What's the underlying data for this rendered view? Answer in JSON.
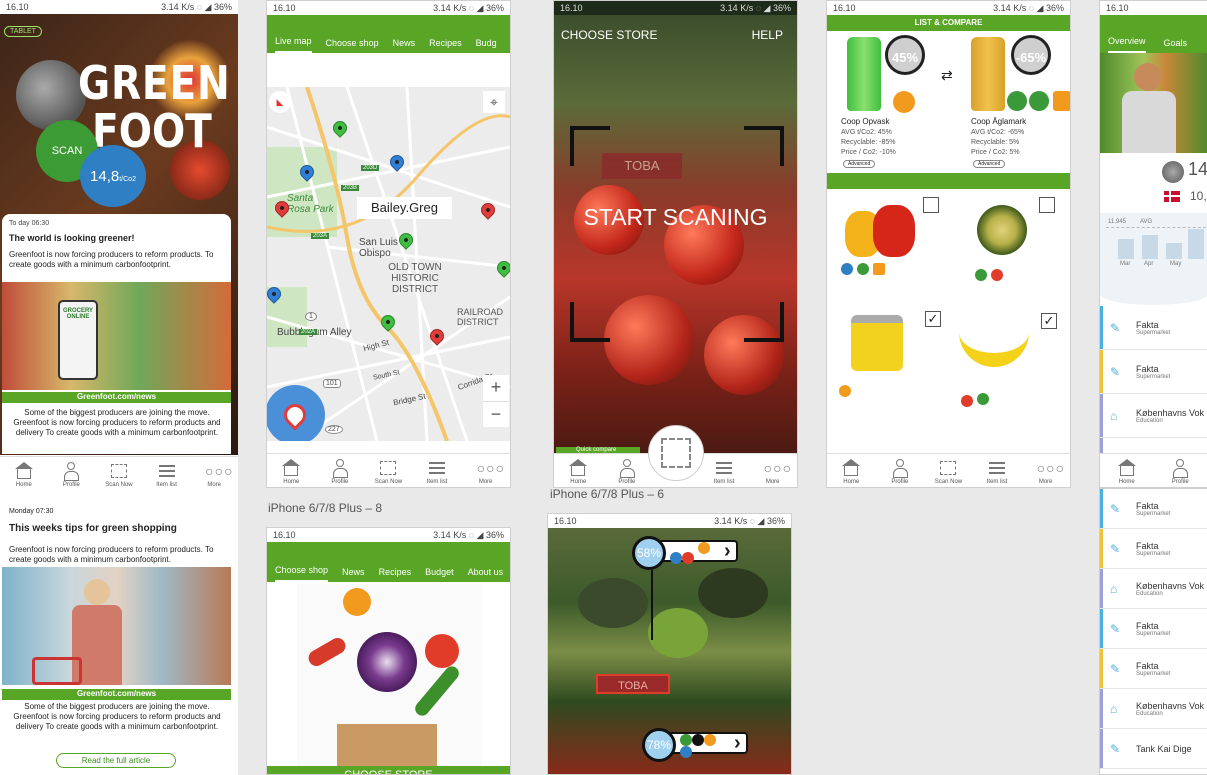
{
  "status": {
    "time": "16.10",
    "speed": "3.14 K/s",
    "battery": "36%"
  },
  "nav": {
    "home": "Home",
    "profile": "Profile",
    "scan": "Scan Now",
    "list": "Item list",
    "more": "More"
  },
  "s1": {
    "badge": "TABLET",
    "logo_line1": "GREEN",
    "logo_line2": "FOOT",
    "scan": "SCAN",
    "co2_value": "14,8",
    "co2_unit": "t/Co2",
    "news1_time": "To day 06:30",
    "news1_title": "The world is looking greener!",
    "news1_body": "Greenfoot is now forcing producers to reform products. To create goods with a minimum carbonfootprint.",
    "grocery": "GROCERY ONLINE",
    "site": "Greenfoot.com/news",
    "news1_more": "Some of the  biggest producers are joining the move. Greenfoot is now forcing producers to reform products and delivery To create goods with a minimum carbonfootprint."
  },
  "s1b": {
    "time": "Monday 07:30",
    "title": "This weeks tips for green shopping",
    "body": "Greenfoot is now forcing producers to reform products. To create goods with a minimum carbonfootprint.",
    "site": "Greenfoot.com/news",
    "more": "Some of the  biggest producers are joining the move. Greenfoot is now forcing producers to reform products and delivery To create goods with a minimum carbonfootprint.",
    "button": "Read the full article"
  },
  "s2": {
    "tabs": [
      "Live map",
      "Choose shop",
      "News",
      "Recipes",
      "Budg"
    ],
    "name_box": "Bailey.Greg",
    "streets": {
      "santa_rosa": "Santa Rosa Park",
      "san_luis": "San Luis Obispo",
      "old_town": "OLD TOWN HISTORIC DISTRICT",
      "railroad": "RAILROAD DISTRICT",
      "bubblegum": "Bubblegum Alley",
      "high": "High St",
      "south": "South St",
      "bridge": "Bridge St",
      "corrida": "Corrida Dr",
      "r101": "101",
      "r227": "227",
      "r1": "1",
      "r203a": "203A",
      "r203b": "203B",
      "r203d": "203D",
      "r202a": "202A"
    }
  },
  "s2_caption": "iPhone 6/7/8 Plus – 8",
  "s2b": {
    "tabs": [
      "Choose shop",
      "News",
      "Recipes",
      "Budget",
      "About us"
    ],
    "footer": "CHOOSE STORE"
  },
  "s3": {
    "choose": "CHOOSE STORE",
    "help": "HELP",
    "scan": "START SCANING",
    "quick": "Quick compare",
    "sign": "TOBA"
  },
  "s3_caption": "iPhone 6/7/8 Plus – 6",
  "s3b": {
    "p1": "58%",
    "p2": "78%",
    "sign": "TOBA"
  },
  "s4": {
    "header": "LIST & COMPARE",
    "p1": {
      "pct": "45%",
      "name": "Coop Opvask",
      "avg": "AVG t/Co2: 45%",
      "rec": "Recyclable: -85%",
      "price": "Price / Co2: -10%",
      "adv": "Advanced"
    },
    "p2": {
      "pct": "-65%",
      "name": "Coop Äglamark",
      "avg": "AVG t/Co2: -65%",
      "rec": "Recyclable:  5%",
      "price": "Price / Co2: 5%",
      "adv": "Advanced"
    }
  },
  "s5": {
    "tabs": [
      "Overview",
      "Goals"
    ],
    "val1": "14",
    "val2": "10,",
    "chart_labels": [
      "11,945",
      "AVG"
    ],
    "months": [
      "Mar",
      "Apr",
      "May"
    ],
    "rows": [
      {
        "t": "Fakta",
        "s": "Supermarket",
        "c": "#4ab0e0"
      },
      {
        "t": "Fakta",
        "s": "Supermarket",
        "c": "#f0c33c"
      },
      {
        "t": "Københavns Vok",
        "s": "Education",
        "c": "#a0a0d8"
      },
      {
        "t": "Tank Kai Dige",
        "s": "",
        "c": "#a0a0d8"
      },
      {
        "t": "Fakta",
        "s": "Supermarket",
        "c": "#4ab0e0"
      },
      {
        "t": "Fakta",
        "s": "Supermarket",
        "c": "#f0c33c"
      },
      {
        "t": "Københavns Vok",
        "s": "Education",
        "c": "#a0a0d8"
      },
      {
        "t": "Fakta",
        "s": "Supermarket",
        "c": "#4ab0e0"
      },
      {
        "t": "Fakta",
        "s": "Supermarket",
        "c": "#f0c33c"
      },
      {
        "t": "Københavns Vok",
        "s": "Education",
        "c": "#a0a0d8"
      },
      {
        "t": "Tank Kai Dige",
        "s": "",
        "c": "#a0a0d8"
      }
    ]
  }
}
